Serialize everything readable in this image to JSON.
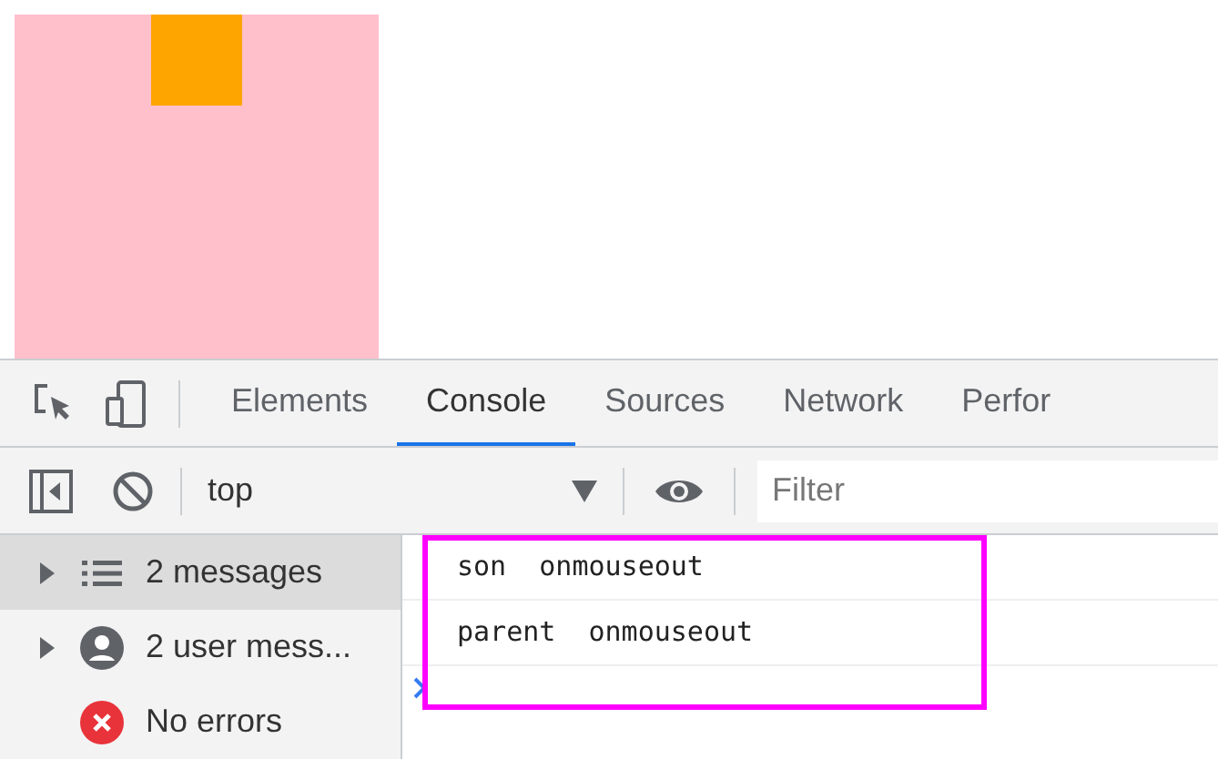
{
  "devtools": {
    "tabs": [
      {
        "label": "Elements",
        "selected": false
      },
      {
        "label": "Console",
        "selected": true
      },
      {
        "label": "Sources",
        "selected": false
      },
      {
        "label": "Network",
        "selected": false
      },
      {
        "label": "Perfor",
        "selected": false
      }
    ],
    "toolbar": {
      "context": "top",
      "filter": {
        "placeholder": "Filter"
      }
    },
    "sidebar": {
      "items": [
        {
          "kind": "messages",
          "label": "2 messages",
          "expandable": true,
          "selected": true
        },
        {
          "kind": "user",
          "label": "2 user mess...",
          "expandable": true,
          "selected": false
        },
        {
          "kind": "errors",
          "label": "No errors",
          "expandable": false,
          "selected": false
        }
      ]
    },
    "console": {
      "messages": [
        "son  onmouseout",
        "parent  onmouseout"
      ]
    }
  }
}
